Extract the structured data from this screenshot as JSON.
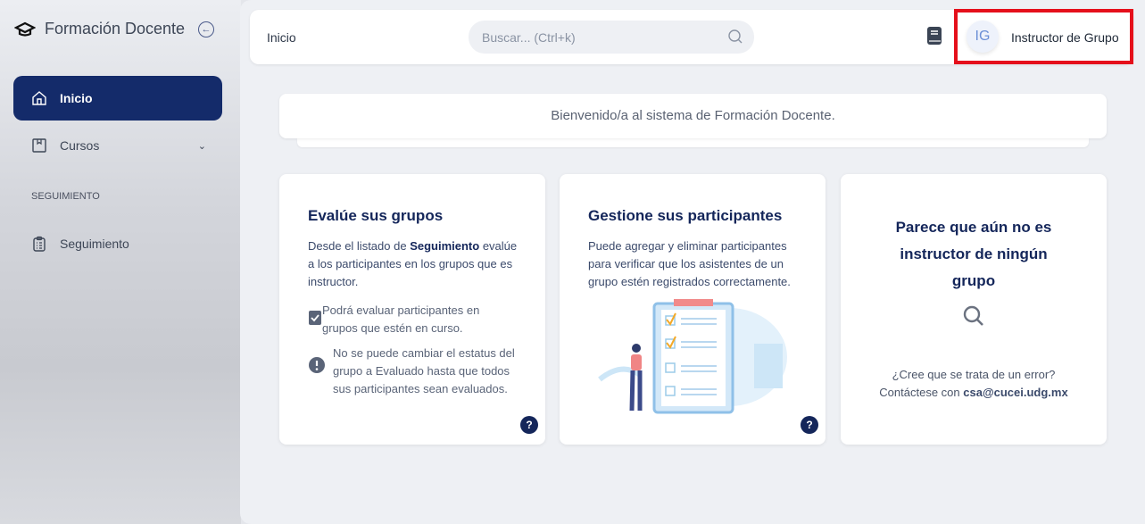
{
  "sidebar": {
    "brand": "Formación Docente",
    "items": [
      {
        "label": "Inicio"
      },
      {
        "label": "Cursos"
      }
    ],
    "section": "SEGUIMIENTO",
    "section_items": [
      {
        "label": "Seguimiento"
      }
    ]
  },
  "header": {
    "breadcrumb": "Inicio",
    "search_placeholder": "Buscar... (Ctrl+k)",
    "avatar_initials": "IG",
    "user_name": "Instructor de Grupo"
  },
  "welcome": "Bienvenido/a al sistema de Formación Docente.",
  "cards": [
    {
      "title": "Evalúe sus grupos",
      "text_pre": "Desde el listado de ",
      "text_bold": "Seguimiento",
      "text_post": " evalúe a los participantes en los grupos que es instructor.",
      "bullets": [
        "Podrá evaluar participantes en grupos que estén en curso.",
        "No se puede cambiar el estatus del grupo a Evaluado hasta que todos sus participantes sean evaluados."
      ],
      "help": "?"
    },
    {
      "title": "Gestione sus participantes",
      "text": "Puede agregar y eliminar participantes para verificar que los asistentes de un grupo estén registrados correctamente.",
      "help": "?"
    },
    {
      "title": "Parece que aún no es instructor de ningún grupo",
      "error_line1": "¿Cree que se trata de un error?",
      "error_pre": "Contáctese con ",
      "email": "csa@cucei.udg.mx"
    }
  ],
  "colors": {
    "primary": "#142b6a",
    "highlight": "#e5101b"
  }
}
